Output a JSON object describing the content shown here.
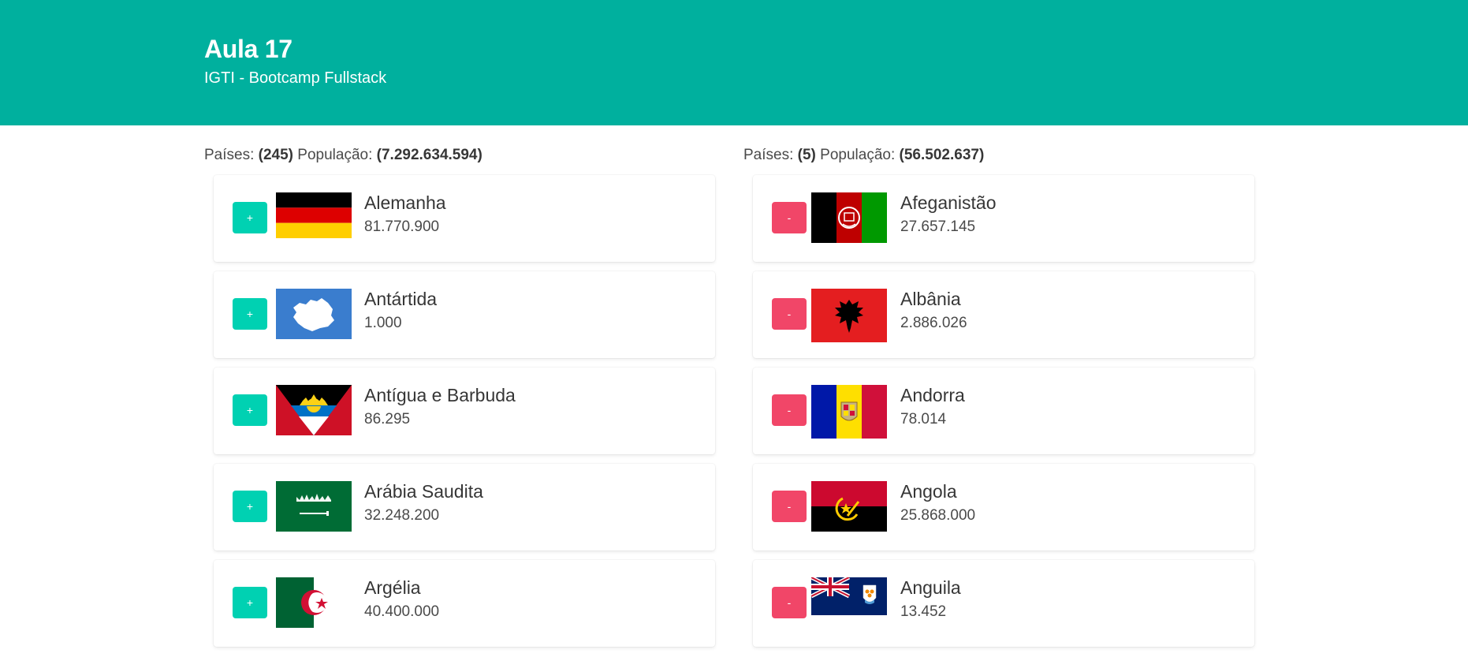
{
  "header": {
    "title": "Aula 17",
    "subtitle": "IGTI - Bootcamp Fullstack"
  },
  "left": {
    "countries_label": "Países:",
    "countries_count": "(245)",
    "population_label": "População:",
    "population_value": "(7.292.634.594)",
    "button_label": "+",
    "items": [
      {
        "name": "Alemanha",
        "population": "81.770.900",
        "flag": "germany-flag"
      },
      {
        "name": "Antártida",
        "population": "1.000",
        "flag": "antarctica-flag"
      },
      {
        "name": "Antígua e Barbuda",
        "population": "86.295",
        "flag": "antigua-flag"
      },
      {
        "name": "Arábia Saudita",
        "population": "32.248.200",
        "flag": "saudi-arabia-flag"
      },
      {
        "name": "Argélia",
        "population": "40.400.000",
        "flag": "algeria-flag"
      }
    ]
  },
  "right": {
    "countries_label": "Países:",
    "countries_count": "(5)",
    "population_label": "População:",
    "population_value": "(56.502.637)",
    "button_label": "-",
    "items": [
      {
        "name": "Afeganistão",
        "population": "27.657.145",
        "flag": "afghanistan-flag"
      },
      {
        "name": "Albânia",
        "population": "2.886.026",
        "flag": "albania-flag"
      },
      {
        "name": "Andorra",
        "population": "78.014",
        "flag": "andorra-flag"
      },
      {
        "name": "Angola",
        "population": "25.868.000",
        "flag": "angola-flag"
      },
      {
        "name": "Anguila",
        "population": "13.452",
        "flag": "anguilla-flag"
      }
    ]
  },
  "colors": {
    "hero": "#00b09e",
    "add_button": "#00d1b2",
    "remove_button": "#f14668"
  }
}
